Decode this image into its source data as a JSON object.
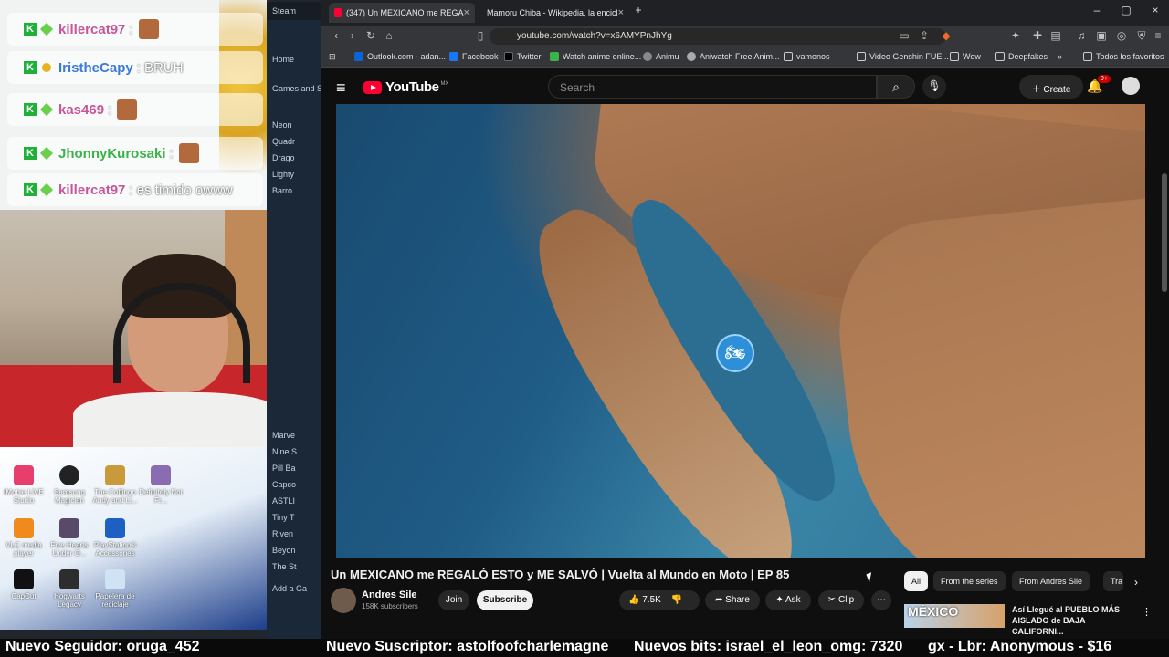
{
  "chat": {
    "messages": [
      {
        "user": "killercat97",
        "color": "#c8569a",
        "text": ":"
      },
      {
        "user": "IristheCapy",
        "color": "#3d7ad6",
        "text": ": BRUH"
      },
      {
        "user": "kas469",
        "color": "#c8569a",
        "text": ":"
      },
      {
        "user": "JhonnyKurosaki",
        "color": "#3ab34a",
        "text": ":"
      },
      {
        "user": "killercat97",
        "color": "#c8569a",
        "text": ": es timido owww"
      }
    ]
  },
  "desktop": {
    "icons": [
      "IMobie LIVE Studio",
      "Samsung Magician",
      "The Coffingo Andy and Li...",
      "Definitely Not Fr...",
      "VLC media player",
      "Five Hearts Under O...",
      "PlayStation® Accessories",
      "CapCut",
      "Hogwarts Legacy",
      "Papelera de reciclaje"
    ]
  },
  "steam": {
    "title": "Steam",
    "items": [
      "Home",
      "Games and S",
      "Neon",
      "Quadr",
      "Drago",
      "Lighty",
      "Barro",
      "Marve",
      "Nine S",
      "Pill Ba",
      "Capco",
      "ASTLI",
      "Tiny T",
      "Riven",
      "Beyon",
      "The St",
      "Add a Ga"
    ]
  },
  "browser": {
    "tabs": [
      {
        "title": "(347) Un MEXICANO me REGA",
        "active": true
      },
      {
        "title": "Mamoru Chiba - Wikipedia, la encicl",
        "active": false
      }
    ],
    "url": "youtube.com/watch?v=x6AMYPnJhYg",
    "bookmarks": [
      "Outlook.com - adan...",
      "Facebook",
      "Twitter",
      "Watch anime online...",
      "Animu",
      "Aniwatch Free Anim...",
      "vamonos",
      "Video Genshin FUE...",
      "Wow",
      "Deepfakes",
      "Todos los favoritos"
    ]
  },
  "youtube": {
    "logo": "YouTube",
    "country": "MX",
    "search_placeholder": "Search",
    "create_label": "Create",
    "notif_badge": "9+",
    "video_title": "Un MEXICANO me REGALÓ ESTO y ME SALVÓ | Vuelta al Mundo en Moto | EP 85",
    "channel_name": "Andres Sile",
    "subscribers": "158K subscribers",
    "join_label": "Join",
    "subscribe_label": "Subscribe",
    "likes": "7.5K",
    "share_label": "Share",
    "ask_label": "Ask",
    "clip_label": "Clip",
    "chips": [
      "All",
      "From the series",
      "From Andres Sile",
      "Tra"
    ],
    "recommended": {
      "thumb_text": "MÉXICO",
      "title": "Así Llegué al PUEBLO MÁS AISLADO de BAJA CALIFORNI..."
    }
  },
  "ticker": {
    "follower": "Nuevo Seguidor: oruga_452",
    "subscriber": "Nuevo Suscriptor: astolfoofcharlemagne",
    "bits": "Nuevos bits: israel_el_leon_omg: 7320",
    "donation": "gx - Lbr: Anonymous - $16"
  },
  "colors": {
    "yt_red": "#ff0033",
    "map_marker": "#2d8fd8"
  }
}
